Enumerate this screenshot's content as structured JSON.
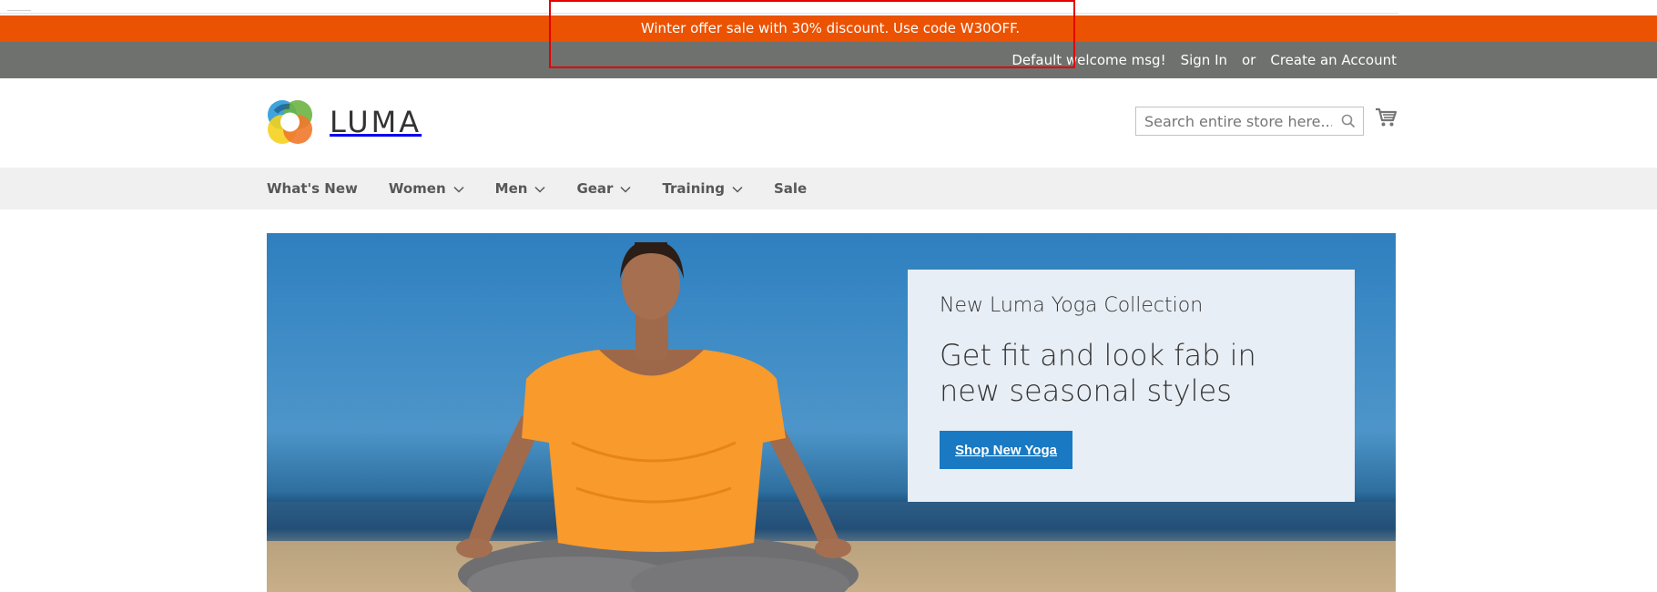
{
  "promo_banner": {
    "text": "Winter offer sale with 30% discount. Use code W30OFF."
  },
  "panel": {
    "welcome": "Default welcome msg!",
    "sign_in": "Sign In",
    "or": "or",
    "create_account": "Create an Account"
  },
  "header": {
    "logo_text": "LUMA",
    "search_placeholder": "Search entire store here...",
    "search_value": ""
  },
  "nav": {
    "items": [
      {
        "label": "What's New",
        "has_dropdown": false
      },
      {
        "label": "Women",
        "has_dropdown": true
      },
      {
        "label": "Men",
        "has_dropdown": true
      },
      {
        "label": "Gear",
        "has_dropdown": true
      },
      {
        "label": "Training",
        "has_dropdown": true
      },
      {
        "label": "Sale",
        "has_dropdown": false
      }
    ]
  },
  "hero": {
    "subtitle": "New Luma Yoga Collection",
    "headline": "Get fit and look fab in new seasonal styles",
    "button": "Shop New Yoga"
  },
  "colors": {
    "promo_bg": "#eb5202",
    "panel_bg": "#6e716e",
    "nav_bg": "#f0f0f0",
    "button_bg": "#1979c3",
    "highlight": "#e50000"
  }
}
